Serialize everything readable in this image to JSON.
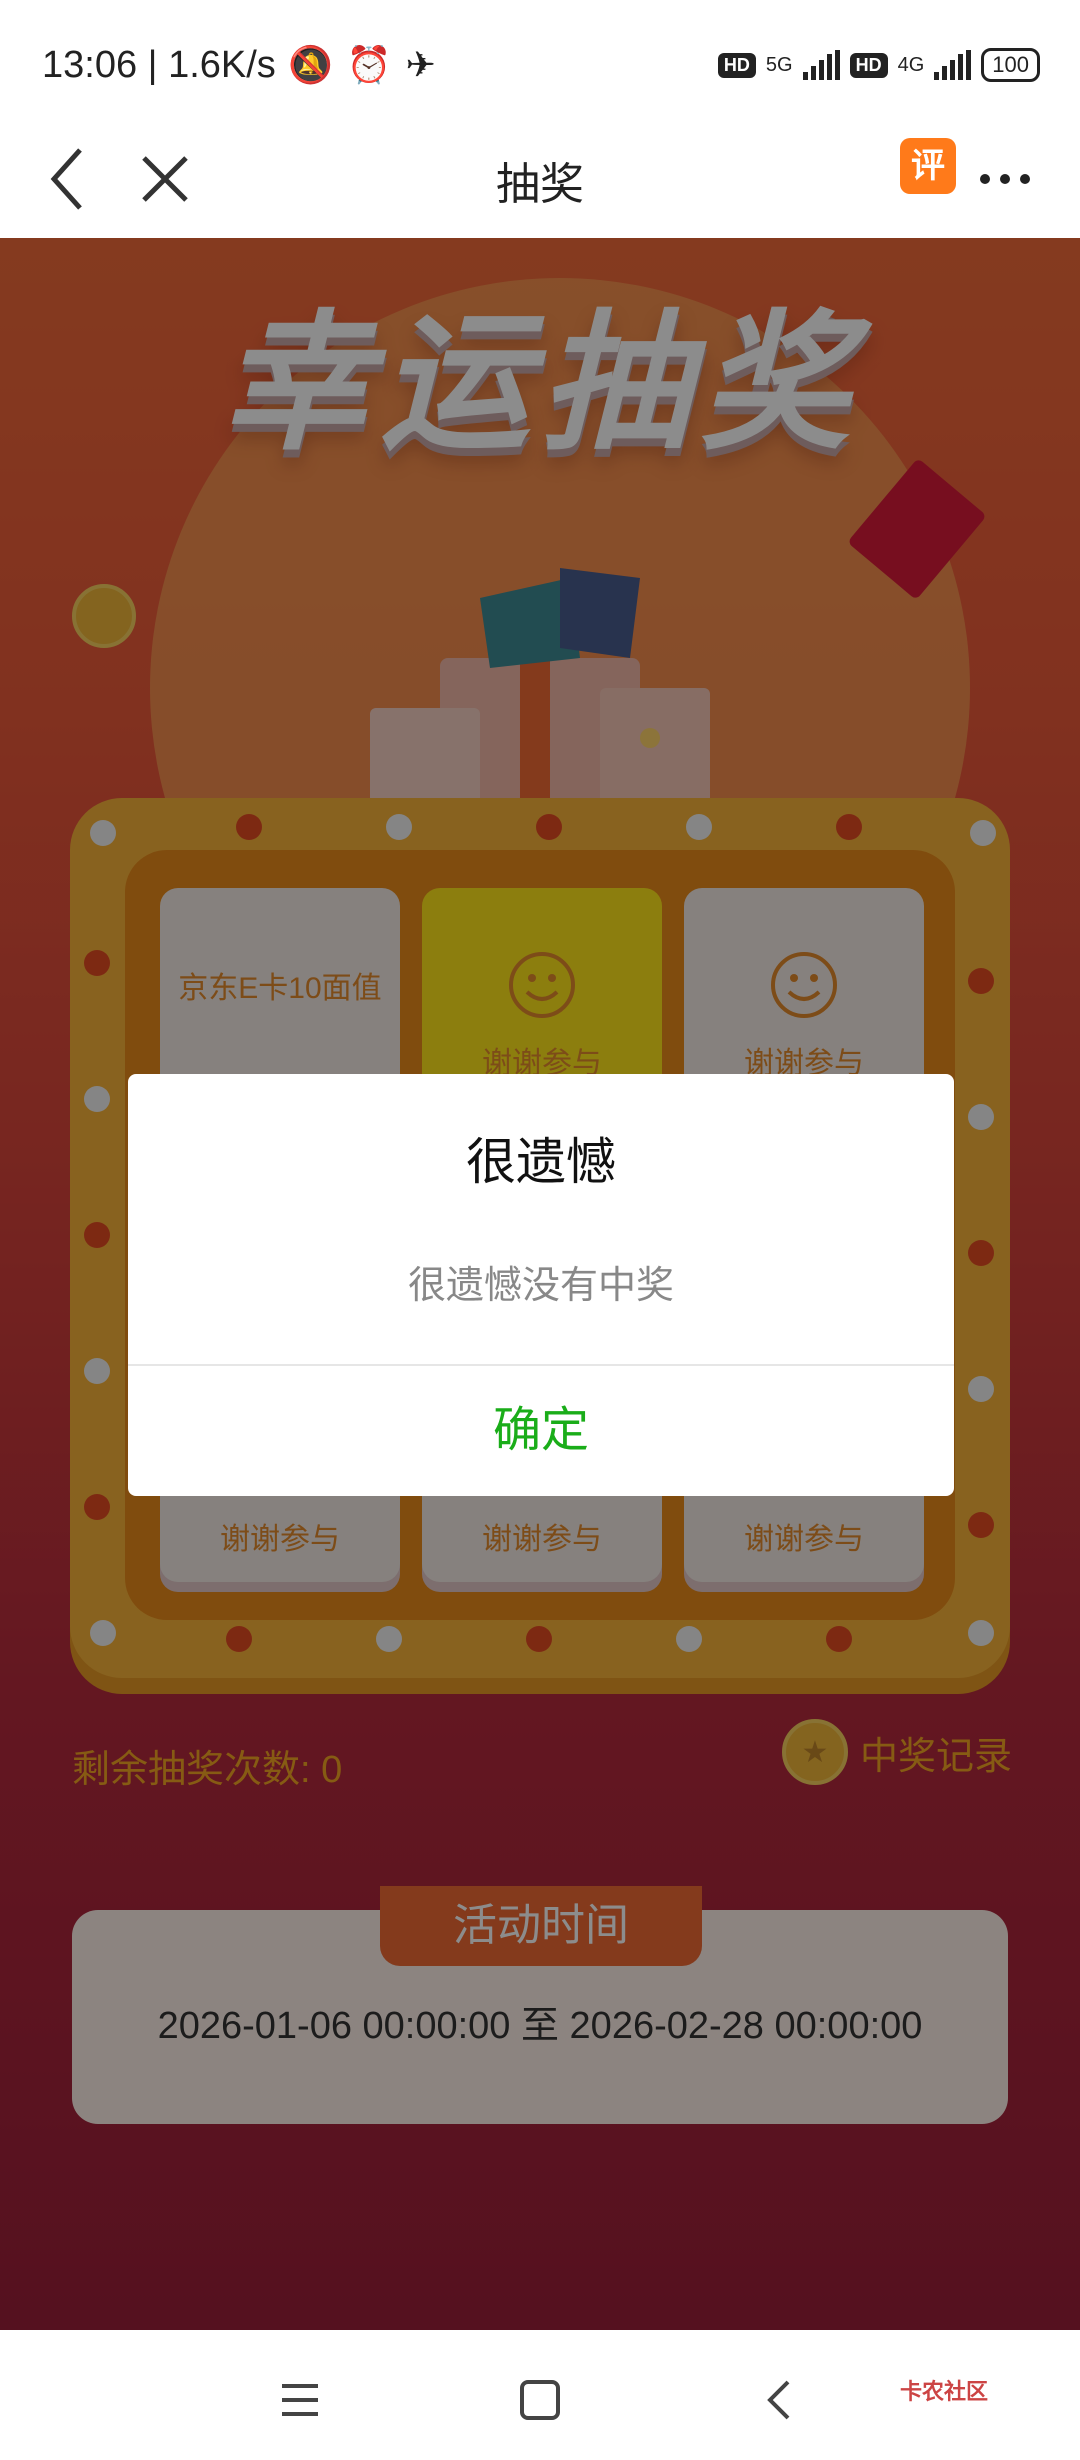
{
  "status_bar": {
    "time_speed": "13:06 | 1.6K/s",
    "hd1": "HD",
    "net1": "5G",
    "hd2": "HD",
    "net2": "4G",
    "battery": "100",
    "icons": [
      "mute-bell-icon",
      "alarm-icon",
      "app-notification-icon"
    ]
  },
  "nav": {
    "title": "抽奖",
    "eval_badge": "评",
    "colors": {
      "eval": "#ff7a1a"
    }
  },
  "banner": {
    "title": "幸运抽奖"
  },
  "grid": {
    "cells": [
      {
        "label": "京东E卡10面值",
        "type": "prize"
      },
      {
        "label": "谢谢参与",
        "type": "thanks",
        "active": true
      },
      {
        "label": "谢谢参与",
        "type": "thanks"
      },
      {
        "label": "谢谢参与",
        "type": "thanks"
      },
      {
        "label": "谢谢参与",
        "type": "thanks"
      },
      {
        "label": "谢谢参与",
        "type": "thanks"
      }
    ]
  },
  "remaining": "剩余抽奖次数: 0",
  "record_link": "中奖记录",
  "activity": {
    "tab": "活动时间",
    "range": "2026-01-06 00:00:00 至 2026-02-28 00:00:00"
  },
  "dialog": {
    "title": "很遗憾",
    "message": "很遗憾没有中奖",
    "confirm": "确定",
    "colors": {
      "confirm": "#1aad19"
    }
  },
  "watermark": "卡农社区"
}
